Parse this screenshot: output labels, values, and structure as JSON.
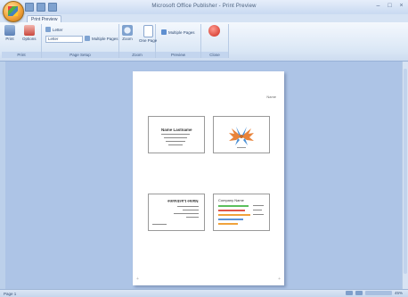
{
  "window": {
    "title": "Microsoft Office Publisher - Print Preview"
  },
  "tabs": {
    "active": "Print Preview"
  },
  "ribbon": {
    "groups": [
      {
        "label": "Print"
      },
      {
        "label": "Page Setup"
      },
      {
        "label": "Zoom"
      },
      {
        "label": "Preview"
      },
      {
        "label": "Close"
      }
    ],
    "buttons": {
      "print": "Print",
      "options": "Options",
      "page_setup_combo": "Letter",
      "show_multiple": "Multiple Pages",
      "zoom": "Zoom",
      "one_page": "One Page",
      "close_preview": "Close Print Preview"
    }
  },
  "page": {
    "header_text": "Name"
  },
  "cards": [
    {
      "kind": "text",
      "title": "Name Lastname",
      "lines": 4
    },
    {
      "kind": "logo"
    },
    {
      "kind": "text-rotated",
      "title": "Name Lastname",
      "lines": 5
    },
    {
      "kind": "colored-lines",
      "title": "Company Name",
      "lines": 5
    }
  ],
  "status": {
    "left": "Page 1",
    "zoom": "45%"
  },
  "colors": {
    "accent": "#2f4a72",
    "ribbon_bg": "#dce8f6",
    "workspace": "#adc4e6",
    "logo_orange": "#e8833a",
    "logo_blue": "#4b8fd4",
    "line_green": "#5cbf5c",
    "line_red": "#e0574a",
    "line_orange": "#f0a23c",
    "line_blue": "#5d93d6"
  }
}
